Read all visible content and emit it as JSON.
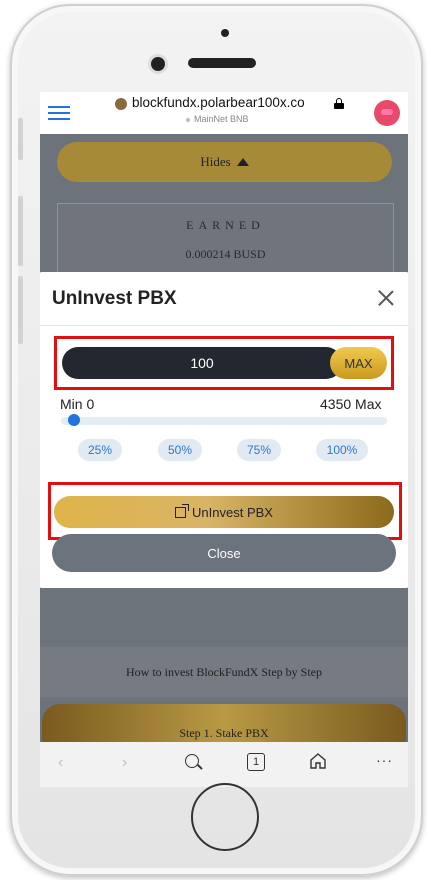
{
  "browser": {
    "domain": "blockfundx.polarbear100x.co",
    "network": "MainNet BNB"
  },
  "page": {
    "hides_label": "Hides",
    "earned_title": "EARNED",
    "earned_value": "0.000214 BUSD",
    "howto_label": "How to invest BlockFundX Step by Step",
    "step1_label": "Step 1. Stake PBX"
  },
  "modal": {
    "title": "UnInvest PBX",
    "amount_value": "100",
    "max_button": "MAX",
    "min_label": "Min 0",
    "max_label": "4350 Max",
    "slider_fraction": 0.023,
    "percent_buttons": [
      "25%",
      "50%",
      "75%",
      "100%"
    ],
    "uninvest_button": "UnInvest PBX",
    "close_button": "Close"
  },
  "colors": {
    "accent_blue": "#1f74e0",
    "gold": "#e0b44a",
    "highlight_red": "#e01010"
  },
  "icons": [
    "menu-icon",
    "lock-icon",
    "close-icon",
    "external-link-icon",
    "back-icon",
    "forward-icon",
    "search-icon",
    "tabs-icon",
    "home-icon",
    "more-icon"
  ],
  "toolbar": {
    "back": "‹",
    "forward": "›",
    "tabs_count": "1",
    "more": "···"
  }
}
